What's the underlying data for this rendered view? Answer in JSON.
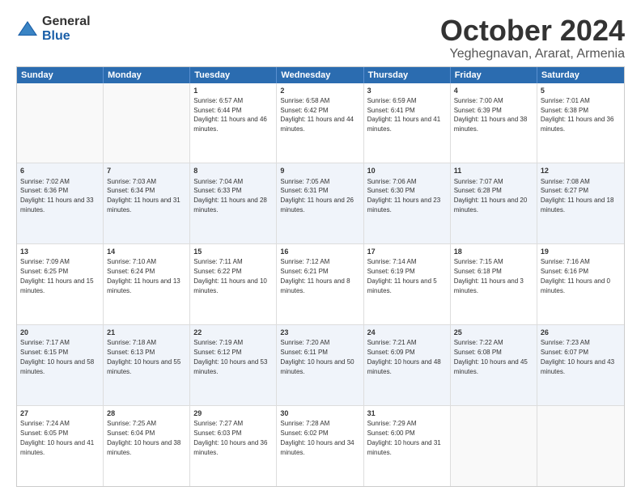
{
  "logo": {
    "general": "General",
    "blue": "Blue"
  },
  "title": "October 2024",
  "location": "Yeghegnavan, Ararat, Armenia",
  "header_days": [
    "Sunday",
    "Monday",
    "Tuesday",
    "Wednesday",
    "Thursday",
    "Friday",
    "Saturday"
  ],
  "weeks": [
    [
      {
        "day": "",
        "sunrise": "",
        "sunset": "",
        "daylight": ""
      },
      {
        "day": "",
        "sunrise": "",
        "sunset": "",
        "daylight": ""
      },
      {
        "day": "1",
        "sunrise": "Sunrise: 6:57 AM",
        "sunset": "Sunset: 6:44 PM",
        "daylight": "Daylight: 11 hours and 46 minutes."
      },
      {
        "day": "2",
        "sunrise": "Sunrise: 6:58 AM",
        "sunset": "Sunset: 6:42 PM",
        "daylight": "Daylight: 11 hours and 44 minutes."
      },
      {
        "day": "3",
        "sunrise": "Sunrise: 6:59 AM",
        "sunset": "Sunset: 6:41 PM",
        "daylight": "Daylight: 11 hours and 41 minutes."
      },
      {
        "day": "4",
        "sunrise": "Sunrise: 7:00 AM",
        "sunset": "Sunset: 6:39 PM",
        "daylight": "Daylight: 11 hours and 38 minutes."
      },
      {
        "day": "5",
        "sunrise": "Sunrise: 7:01 AM",
        "sunset": "Sunset: 6:38 PM",
        "daylight": "Daylight: 11 hours and 36 minutes."
      }
    ],
    [
      {
        "day": "6",
        "sunrise": "Sunrise: 7:02 AM",
        "sunset": "Sunset: 6:36 PM",
        "daylight": "Daylight: 11 hours and 33 minutes."
      },
      {
        "day": "7",
        "sunrise": "Sunrise: 7:03 AM",
        "sunset": "Sunset: 6:34 PM",
        "daylight": "Daylight: 11 hours and 31 minutes."
      },
      {
        "day": "8",
        "sunrise": "Sunrise: 7:04 AM",
        "sunset": "Sunset: 6:33 PM",
        "daylight": "Daylight: 11 hours and 28 minutes."
      },
      {
        "day": "9",
        "sunrise": "Sunrise: 7:05 AM",
        "sunset": "Sunset: 6:31 PM",
        "daylight": "Daylight: 11 hours and 26 minutes."
      },
      {
        "day": "10",
        "sunrise": "Sunrise: 7:06 AM",
        "sunset": "Sunset: 6:30 PM",
        "daylight": "Daylight: 11 hours and 23 minutes."
      },
      {
        "day": "11",
        "sunrise": "Sunrise: 7:07 AM",
        "sunset": "Sunset: 6:28 PM",
        "daylight": "Daylight: 11 hours and 20 minutes."
      },
      {
        "day": "12",
        "sunrise": "Sunrise: 7:08 AM",
        "sunset": "Sunset: 6:27 PM",
        "daylight": "Daylight: 11 hours and 18 minutes."
      }
    ],
    [
      {
        "day": "13",
        "sunrise": "Sunrise: 7:09 AM",
        "sunset": "Sunset: 6:25 PM",
        "daylight": "Daylight: 11 hours and 15 minutes."
      },
      {
        "day": "14",
        "sunrise": "Sunrise: 7:10 AM",
        "sunset": "Sunset: 6:24 PM",
        "daylight": "Daylight: 11 hours and 13 minutes."
      },
      {
        "day": "15",
        "sunrise": "Sunrise: 7:11 AM",
        "sunset": "Sunset: 6:22 PM",
        "daylight": "Daylight: 11 hours and 10 minutes."
      },
      {
        "day": "16",
        "sunrise": "Sunrise: 7:12 AM",
        "sunset": "Sunset: 6:21 PM",
        "daylight": "Daylight: 11 hours and 8 minutes."
      },
      {
        "day": "17",
        "sunrise": "Sunrise: 7:14 AM",
        "sunset": "Sunset: 6:19 PM",
        "daylight": "Daylight: 11 hours and 5 minutes."
      },
      {
        "day": "18",
        "sunrise": "Sunrise: 7:15 AM",
        "sunset": "Sunset: 6:18 PM",
        "daylight": "Daylight: 11 hours and 3 minutes."
      },
      {
        "day": "19",
        "sunrise": "Sunrise: 7:16 AM",
        "sunset": "Sunset: 6:16 PM",
        "daylight": "Daylight: 11 hours and 0 minutes."
      }
    ],
    [
      {
        "day": "20",
        "sunrise": "Sunrise: 7:17 AM",
        "sunset": "Sunset: 6:15 PM",
        "daylight": "Daylight: 10 hours and 58 minutes."
      },
      {
        "day": "21",
        "sunrise": "Sunrise: 7:18 AM",
        "sunset": "Sunset: 6:13 PM",
        "daylight": "Daylight: 10 hours and 55 minutes."
      },
      {
        "day": "22",
        "sunrise": "Sunrise: 7:19 AM",
        "sunset": "Sunset: 6:12 PM",
        "daylight": "Daylight: 10 hours and 53 minutes."
      },
      {
        "day": "23",
        "sunrise": "Sunrise: 7:20 AM",
        "sunset": "Sunset: 6:11 PM",
        "daylight": "Daylight: 10 hours and 50 minutes."
      },
      {
        "day": "24",
        "sunrise": "Sunrise: 7:21 AM",
        "sunset": "Sunset: 6:09 PM",
        "daylight": "Daylight: 10 hours and 48 minutes."
      },
      {
        "day": "25",
        "sunrise": "Sunrise: 7:22 AM",
        "sunset": "Sunset: 6:08 PM",
        "daylight": "Daylight: 10 hours and 45 minutes."
      },
      {
        "day": "26",
        "sunrise": "Sunrise: 7:23 AM",
        "sunset": "Sunset: 6:07 PM",
        "daylight": "Daylight: 10 hours and 43 minutes."
      }
    ],
    [
      {
        "day": "27",
        "sunrise": "Sunrise: 7:24 AM",
        "sunset": "Sunset: 6:05 PM",
        "daylight": "Daylight: 10 hours and 41 minutes."
      },
      {
        "day": "28",
        "sunrise": "Sunrise: 7:25 AM",
        "sunset": "Sunset: 6:04 PM",
        "daylight": "Daylight: 10 hours and 38 minutes."
      },
      {
        "day": "29",
        "sunrise": "Sunrise: 7:27 AM",
        "sunset": "Sunset: 6:03 PM",
        "daylight": "Daylight: 10 hours and 36 minutes."
      },
      {
        "day": "30",
        "sunrise": "Sunrise: 7:28 AM",
        "sunset": "Sunset: 6:02 PM",
        "daylight": "Daylight: 10 hours and 34 minutes."
      },
      {
        "day": "31",
        "sunrise": "Sunrise: 7:29 AM",
        "sunset": "Sunset: 6:00 PM",
        "daylight": "Daylight: 10 hours and 31 minutes."
      },
      {
        "day": "",
        "sunrise": "",
        "sunset": "",
        "daylight": ""
      },
      {
        "day": "",
        "sunrise": "",
        "sunset": "",
        "daylight": ""
      }
    ]
  ]
}
